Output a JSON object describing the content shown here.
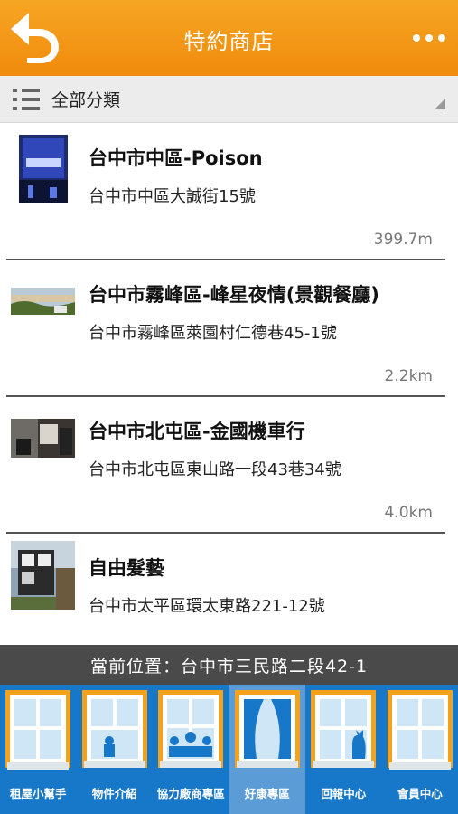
{
  "header": {
    "title": "特約商店",
    "back_icon": "back-arrow-icon",
    "more_icon": "more-dots-icon",
    "color": "#f39b1a"
  },
  "category": {
    "label": "全部分類",
    "icon": "list-icon"
  },
  "stores": [
    {
      "name": "台中市中區-Poison",
      "address": "台中市中區大誠街15號",
      "distance": "399.7m"
    },
    {
      "name": "台中市霧峰區-峰星夜情(景觀餐廳)",
      "address": "台中市霧峰區萊園村仁德巷45-1號",
      "distance": "2.2km"
    },
    {
      "name": "台中市北屯區-金國機車行",
      "address": "台中市北屯區東山路一段43巷34號",
      "distance": "4.0km"
    },
    {
      "name": "自由髮藝",
      "address": "台中市太平區環太東路221-12號",
      "distance": ""
    }
  ],
  "location": {
    "text": "當前位置：台中市三民路二段42-1"
  },
  "bottom_nav": {
    "items": [
      {
        "label": "租屋小幫手",
        "icon": "window-icon"
      },
      {
        "label": "物件介紹",
        "icon": "window-plant-icon"
      },
      {
        "label": "協力廠商專區",
        "icon": "window-flowers-icon"
      },
      {
        "label": "好康專區",
        "icon": "window-curtain-icon",
        "active": true
      },
      {
        "label": "回報中心",
        "icon": "window-cat-icon"
      },
      {
        "label": "會員中心",
        "icon": "window-icon"
      }
    ],
    "color": "#1777c9",
    "active_color": "#5b9cd6"
  }
}
